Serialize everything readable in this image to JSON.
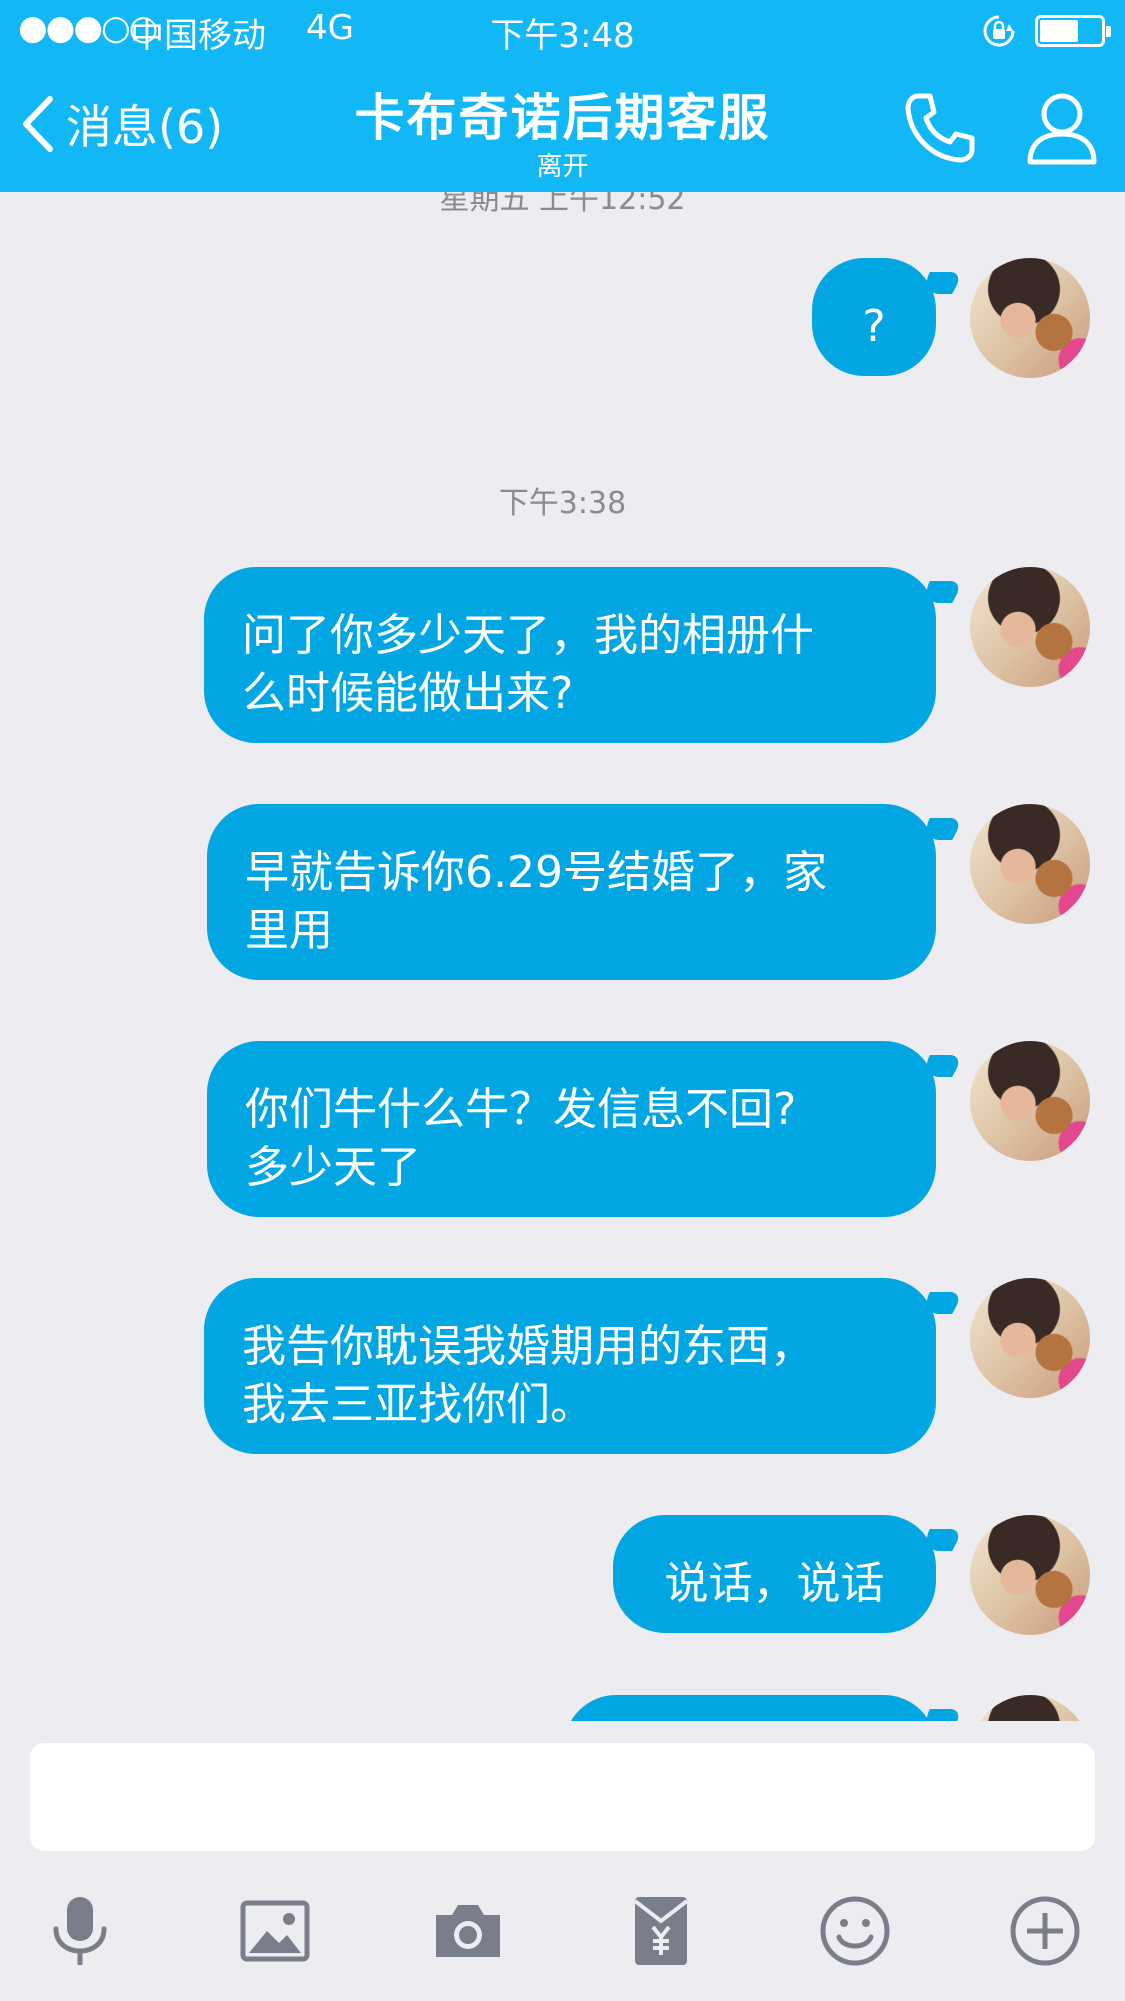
{
  "status_bar": {
    "signal": "●●●○○",
    "carrier": "中国移动",
    "network": "4G",
    "time": "下午3:48"
  },
  "header": {
    "back_label": "消息(6)",
    "title": "卡布奇诺后期客服",
    "status": "离开"
  },
  "chat": {
    "earlier_timestamp": "星期五 上午12:52",
    "timestamp": "下午3:38",
    "messages": [
      {
        "text": "?"
      },
      {
        "text": "问了你多少天了，我的相册什\n么时候能做出来?"
      },
      {
        "text": "早就告诉你6.29号结婚了，家\n里用"
      },
      {
        "text": "你们牛什么牛？发信息不回?\n多少天了"
      },
      {
        "text": "我告你耽误我婚期用的东西，\n我去三亚找你们。"
      },
      {
        "text": "说话，说话"
      },
      {
        "text": ""
      }
    ]
  },
  "input": {
    "value": "",
    "placeholder": ""
  },
  "toolbar": [
    "microphone-icon",
    "image-icon",
    "camera-icon",
    "red-packet-icon",
    "emoji-icon",
    "plus-icon"
  ],
  "colors": {
    "header": "#12b7f5",
    "bubble": "#01a6e3",
    "background": "#ececf1",
    "toolbar_icon": "#7a7e8a"
  }
}
